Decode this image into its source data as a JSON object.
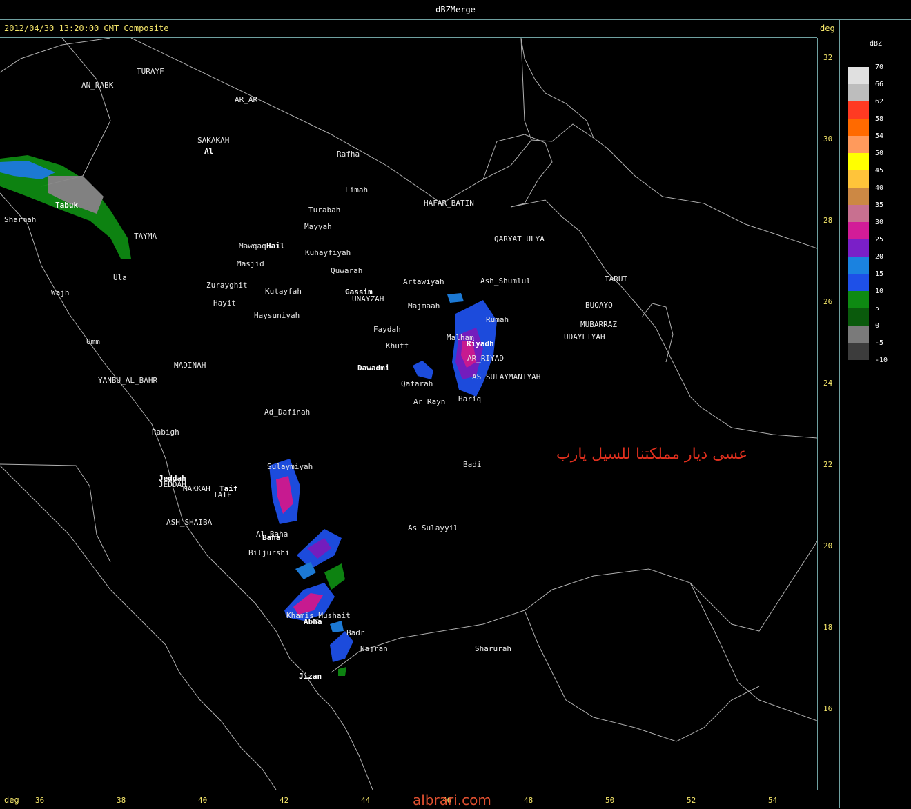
{
  "window": {
    "title": "dBZMerge"
  },
  "header": {
    "timestamp": "2012/04/30 13:20:00 GMT Composite",
    "axis_unit_top": "deg",
    "axis_unit_bottom": "deg"
  },
  "colors": {
    "axis_text": "#f5e66a",
    "frame": "#6fa0a0",
    "border": "#b0b0b0",
    "annotation": "#e0301e"
  },
  "y_axis": {
    "ticks": [
      "32",
      "30",
      "28",
      "26",
      "24",
      "22",
      "20",
      "18",
      "16"
    ]
  },
  "x_axis": {
    "ticks": [
      "36",
      "38",
      "40",
      "42",
      "44",
      "46",
      "48",
      "50",
      "52",
      "54"
    ]
  },
  "legend": {
    "unit": "dBZ",
    "entries": [
      {
        "label": "70",
        "color": "#e0e0e0"
      },
      {
        "label": "66",
        "color": "#bdbdbd"
      },
      {
        "label": "62",
        "color": "#ff3a22"
      },
      {
        "label": "58",
        "color": "#ff6a00"
      },
      {
        "label": "54",
        "color": "#ff9a5c"
      },
      {
        "label": "50",
        "color": "#ffff00"
      },
      {
        "label": "45",
        "color": "#ffc43a"
      },
      {
        "label": "40",
        "color": "#cc8844"
      },
      {
        "label": "35",
        "color": "#c87090"
      },
      {
        "label": "30",
        "color": "#d21c98"
      },
      {
        "label": "25",
        "color": "#7a1fc8"
      },
      {
        "label": "20",
        "color": "#1a82e0"
      },
      {
        "label": "15",
        "color": "#1e50e8"
      },
      {
        "label": "10",
        "color": "#0e8a12"
      },
      {
        "label": "5",
        "color": "#0a5a0c"
      },
      {
        "label": "0",
        "color": "#7a7a7a"
      },
      {
        "label": "-5",
        "color": "#3c3c3c"
      },
      {
        "label": "-10",
        "color": ""
      }
    ]
  },
  "cities": [
    "TURAYF",
    "AN_NABK",
    "AR_AR",
    "SAKAKAH",
    "Al",
    "Rafha",
    "Limah",
    "HAFAR_BATIN",
    "Turabah",
    "Mayyah",
    "Tabuk",
    "Sharmah",
    "TAYMA",
    "QARYAT_ULYA",
    "Mawqaq",
    "Hail",
    "Kuhayfiyah",
    "Masjid",
    "Quwarah",
    "Ula",
    "Zurayghit",
    "Kutayfah",
    "Artawiyah",
    "Ash_Shumlul",
    "TARUT",
    "Wajh",
    "Hayit",
    "Gassim",
    "UNAYZAH",
    "BUQAYQ",
    "Majmaah",
    "Rumah",
    "Haysuniyah",
    "MUBARRAZ",
    "Faydah",
    "UDAYLIYAH",
    "Umm",
    "Khuff",
    "Malham",
    "Riyadh",
    "AR_RIYAD",
    "MADINAH",
    "Dawadmi",
    "AS_SULAYMANIYAH",
    "YANBU_AL_BAHR",
    "Qafarah",
    "Hariq",
    "Ar_Rayn",
    "Ad_Dafinah",
    "Rabigh",
    "Badi",
    "Sulaymiyah",
    "Jeddah",
    "JEDDAH",
    "MAKKAH",
    "Taif",
    "TAIF",
    "ASH_SHAIBA",
    "Al_Baha",
    "Baha",
    "As_Sulayyil",
    "Biljurshi",
    "Khamis_Mushait",
    "Abha",
    "Badr",
    "Najran",
    "Sharurah",
    "Jizan"
  ],
  "annotation": "عسى ديار مملكتنا للسيل يارب",
  "watermark": "albrari.com"
}
